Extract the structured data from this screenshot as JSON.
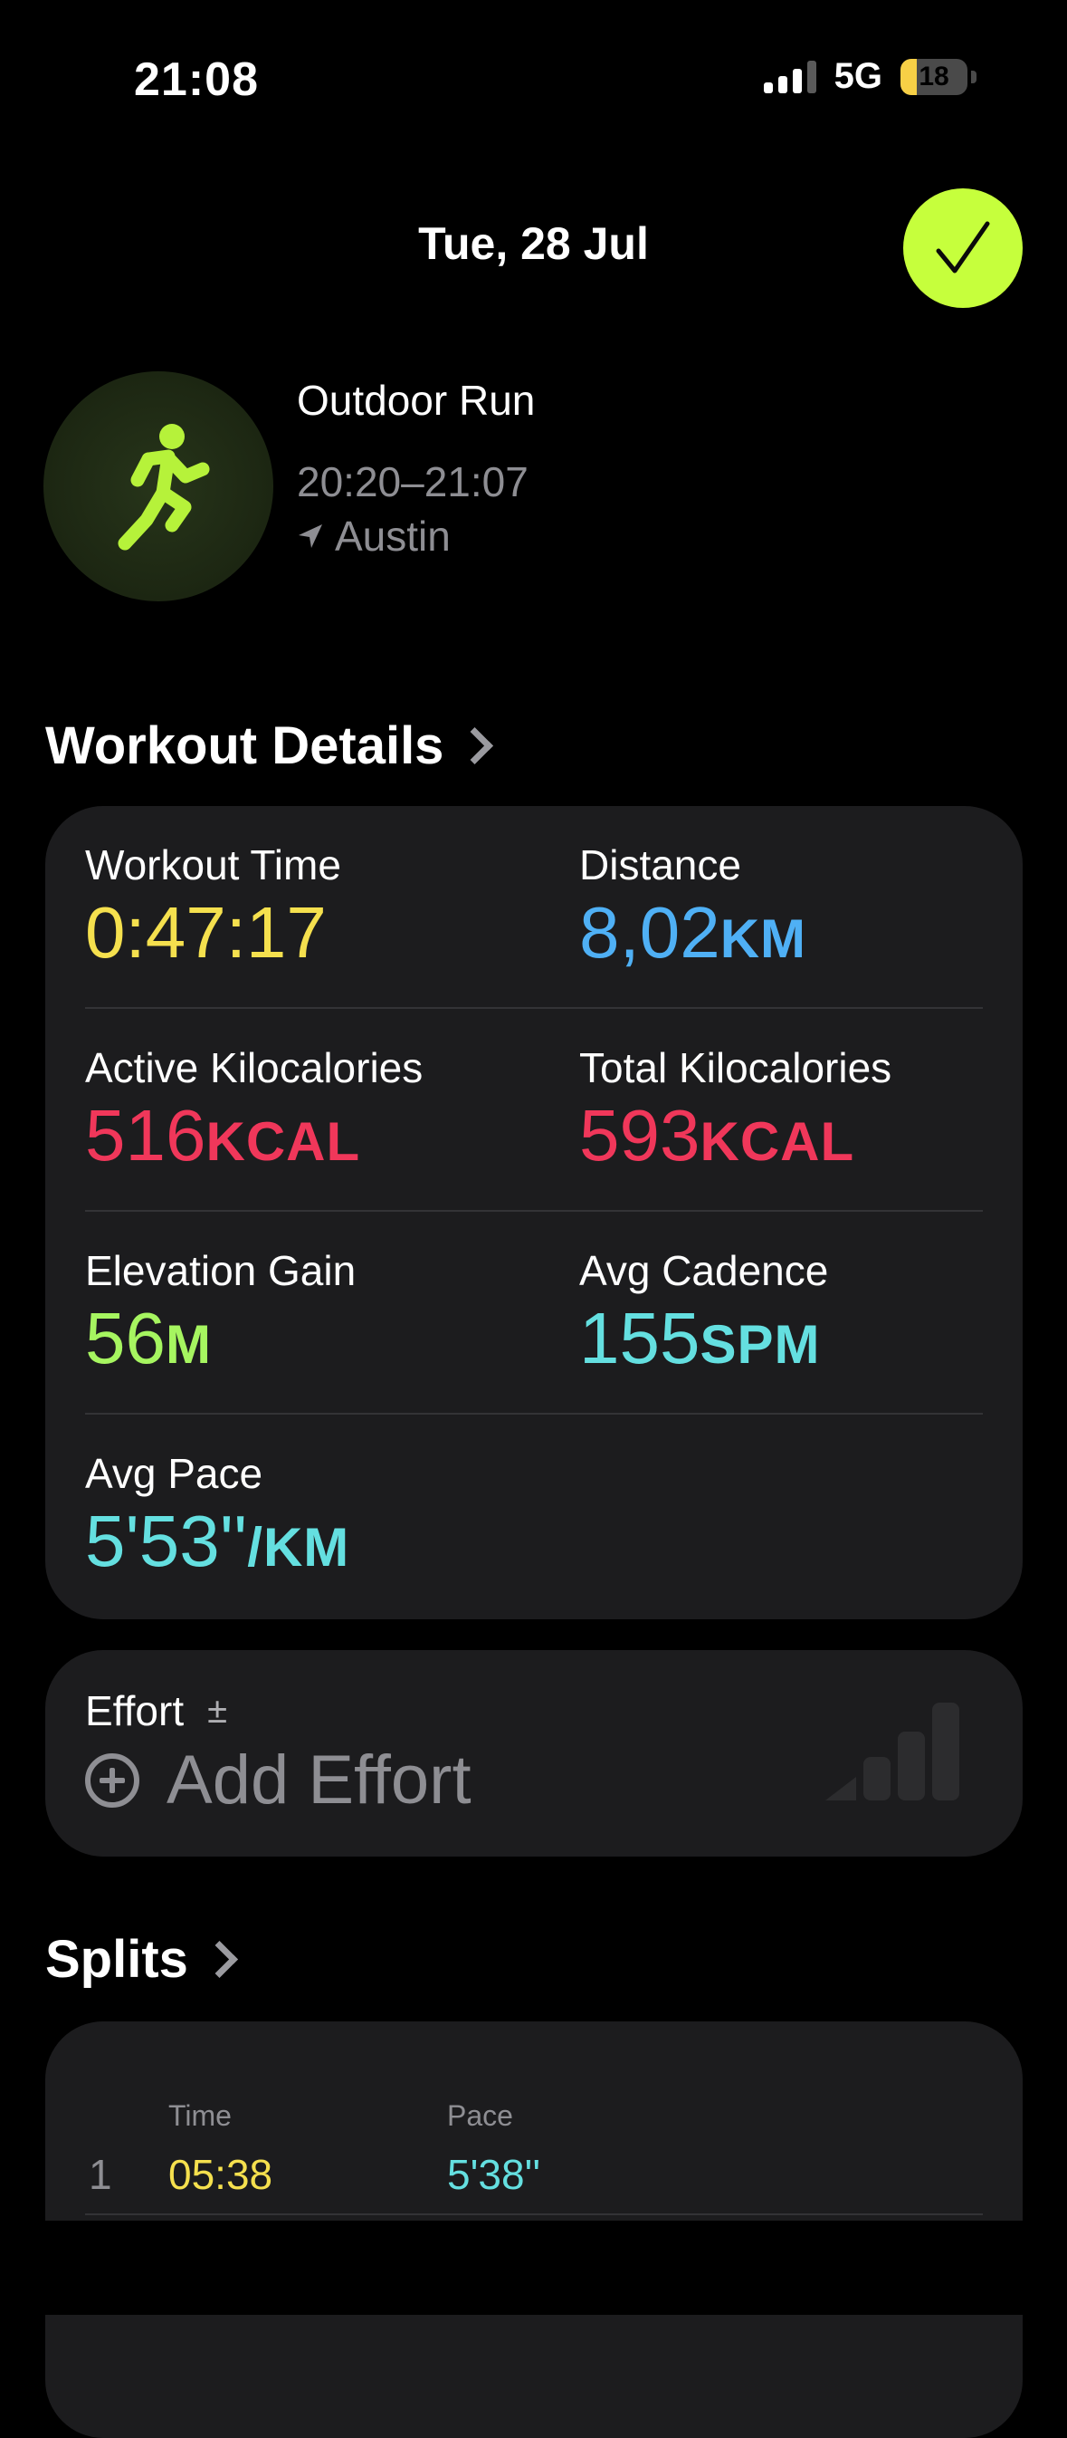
{
  "status": {
    "time": "21:08",
    "network": "5G",
    "battery": "18"
  },
  "header": {
    "date": "Tue, 28 Jul",
    "done_icon": "checkmark-icon"
  },
  "workout": {
    "name": "Outdoor Run",
    "time_range": "20:20–21:07",
    "location": "Austin",
    "icon": "running-figure-icon"
  },
  "details": {
    "title": "Workout Details",
    "metrics": [
      {
        "label": "Workout Time",
        "value": "0:47:17",
        "unit": "",
        "color": "#f5e04e"
      },
      {
        "label": "Distance",
        "value": "8,02",
        "unit": "KM",
        "color": "#4fb0f5"
      },
      {
        "label": "Active Kilocalories",
        "value": "516",
        "unit": "KCAL",
        "color": "#f0375a"
      },
      {
        "label": "Total Kilocalories",
        "value": "593",
        "unit": "KCAL",
        "color": "#f0375a"
      },
      {
        "label": "Elevation Gain",
        "value": "56",
        "unit": "M",
        "color": "#a6f560"
      },
      {
        "label": "Avg Cadence",
        "value": "155",
        "unit": "SPM",
        "color": "#64dfe0"
      },
      {
        "label": "Avg Pace",
        "value": "5'53''",
        "unit": "/KM",
        "color": "#64dfe0"
      }
    ]
  },
  "effort": {
    "label": "Effort",
    "adjust_symbol": "±",
    "add_label": "Add Effort"
  },
  "splits": {
    "title": "Splits",
    "columns": [
      "Time",
      "Pace"
    ],
    "rows": [
      {
        "index": "1",
        "time": "05:38",
        "pace": "5'38''"
      }
    ]
  },
  "colors": {
    "accent": "#c6ff3c",
    "card_bg": "#1c1c1e",
    "time": "#f5e04e",
    "pace": "#64dfe0"
  }
}
